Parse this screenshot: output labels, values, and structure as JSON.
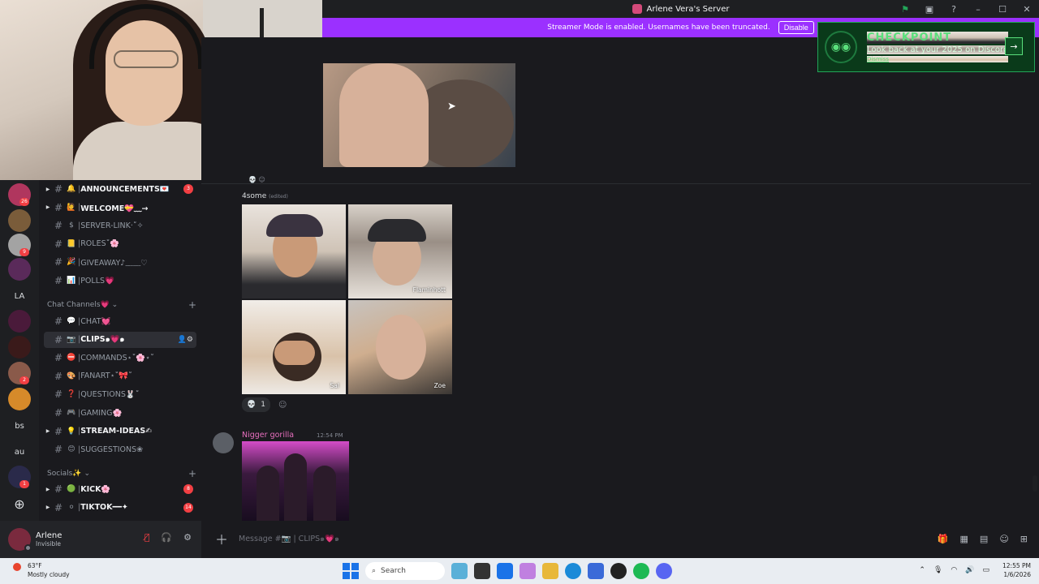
{
  "window": {
    "title": "Arlene Vera's Server"
  },
  "banner": {
    "text": "Streamer Mode is enabled. Usernames have been truncated.",
    "disable_label": "Disable"
  },
  "checkpoint": {
    "title": "CHECKPOINT",
    "subtitle": "Look back at your 2025 on Discord",
    "dismiss": "Dismiss"
  },
  "servers": [
    {
      "text": "",
      "badge": "26",
      "color": "#b0365e"
    },
    {
      "text": "",
      "badge": "",
      "color": "#7a5c3a"
    },
    {
      "text": "",
      "badge": "9",
      "color": "#a3a3a3"
    },
    {
      "text": "",
      "badge": "",
      "color": "#5a2a5a"
    },
    {
      "text": "LA",
      "badge": "",
      "color": ""
    },
    {
      "text": "",
      "badge": "",
      "color": "#4a1a3a"
    },
    {
      "text": "",
      "badge": "",
      "color": "#3a1a1a"
    },
    {
      "text": "",
      "badge": "2",
      "color": "#8a5a4a"
    },
    {
      "text": "",
      "badge": "",
      "color": "#d68a2a"
    },
    {
      "text": "bs",
      "badge": "",
      "color": ""
    },
    {
      "text": "au",
      "badge": "",
      "color": ""
    },
    {
      "text": "",
      "badge": "1",
      "color": "#2a2a4a"
    }
  ],
  "channels": {
    "top": [
      {
        "arrow": true,
        "emoji": "🔔",
        "name": "ANNOUNCEMENTS💌",
        "badge": "3",
        "unread": true
      },
      {
        "arrow": true,
        "emoji": "🙋",
        "name": "WELCOME💝﹏→",
        "badge": "",
        "unread": true
      },
      {
        "arrow": false,
        "emoji": "$",
        "name": "SERVER-LINK·˚✧",
        "badge": "",
        "unread": false
      },
      {
        "arrow": false,
        "emoji": "📒",
        "name": "ROLES˚🌸",
        "badge": "",
        "unread": false
      },
      {
        "arrow": false,
        "emoji": "🎉",
        "name": "GIVEAWAY♪﹏﹏♡",
        "badge": "",
        "unread": false
      },
      {
        "arrow": false,
        "emoji": "📊",
        "name": "POLLS💗",
        "badge": "",
        "unread": false
      }
    ],
    "cat_chat": "Chat Channels💗 ⌄",
    "chat": [
      {
        "arrow": false,
        "emoji": "💬",
        "name": "CHAT💓",
        "badge": "",
        "unread": false,
        "active": false
      },
      {
        "arrow": false,
        "emoji": "📷",
        "name": "CLIPS๑💗๑",
        "badge": "",
        "unread": false,
        "active": true
      },
      {
        "arrow": false,
        "emoji": "⛔",
        "name": "COMMANDS⋆˚🌸⋆˚",
        "badge": "",
        "unread": false,
        "active": false
      },
      {
        "arrow": false,
        "emoji": "🎨",
        "name": "FANART⋆˚🎀˚",
        "badge": "",
        "unread": false,
        "active": false
      },
      {
        "arrow": false,
        "emoji": "❓",
        "name": "QUESTIONS🐰˚",
        "badge": "",
        "unread": false,
        "active": false
      },
      {
        "arrow": false,
        "emoji": "🎮",
        "name": "GAMING🌸",
        "badge": "",
        "unread": false,
        "active": false
      },
      {
        "arrow": true,
        "emoji": "💡",
        "name": "STREAM-IDEAS✍",
        "badge": "",
        "unread": true,
        "active": false
      },
      {
        "arrow": false,
        "emoji": "😊",
        "name": "SUGGESTIONS❀",
        "badge": "",
        "unread": false,
        "active": false
      }
    ],
    "cat_socials": "Socials✨ ⌄",
    "socials": [
      {
        "arrow": true,
        "emoji": "🟢",
        "name": "KICK🌸",
        "badge": "8",
        "unread": true
      },
      {
        "arrow": true,
        "emoji": "⚪",
        "name": "TIKTOK━━✦",
        "badge": "14",
        "unread": true
      }
    ]
  },
  "user": {
    "name": "Arlene",
    "status": "Invisible"
  },
  "messages": {
    "msg1_caption": "4some",
    "msg1_edited": "(edited)",
    "tiles": [
      "",
      "Flaminhott",
      "Sal",
      "Zoe"
    ],
    "reaction_count": "1",
    "msg2_author": "Nigger gorilla",
    "msg2_time": "12:54 PM"
  },
  "composer": {
    "placeholder": "Message #📷 | CLIPS๑💗๑"
  },
  "taskbar": {
    "temp": "63°F",
    "weather": "Mostly cloudy",
    "search": "Search",
    "time": "12:55 PM",
    "date": "1/6/2026"
  }
}
